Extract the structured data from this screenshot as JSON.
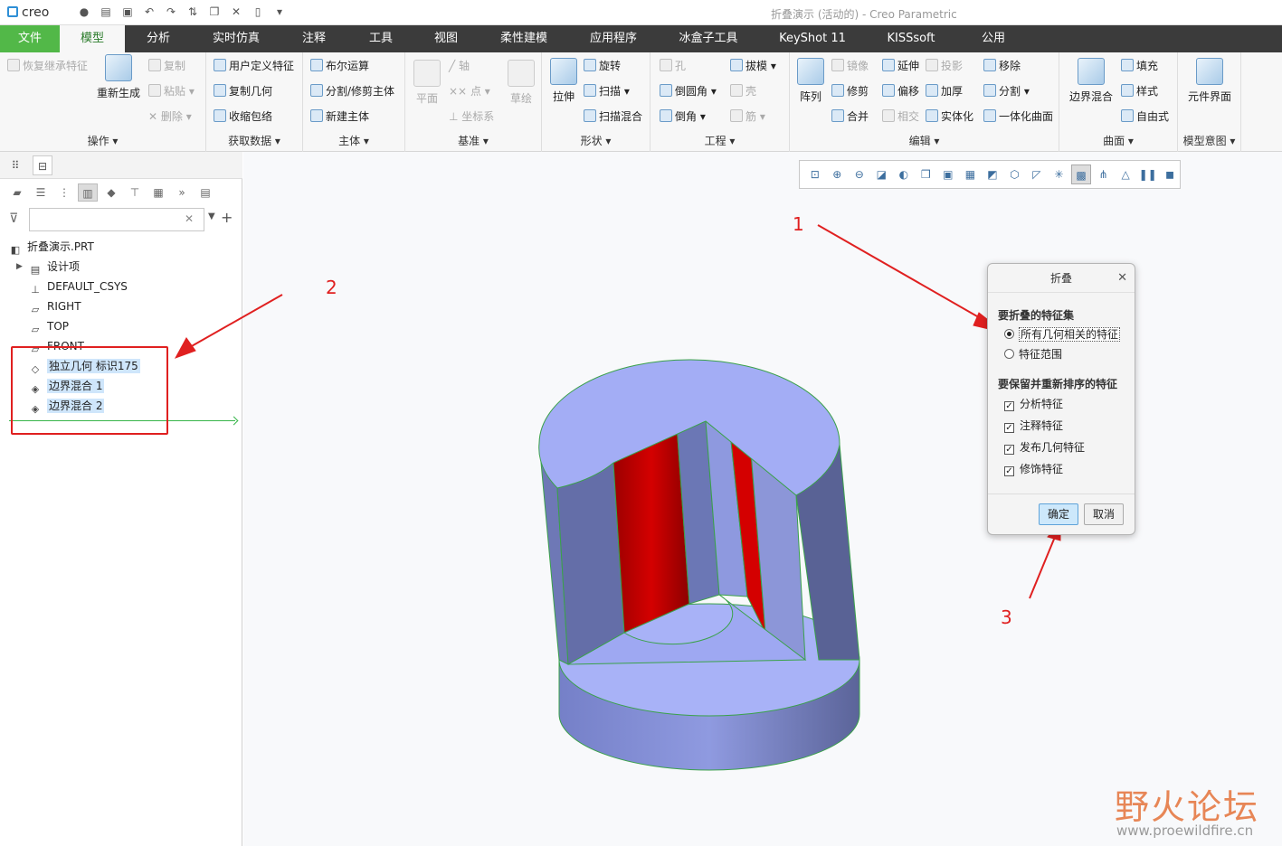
{
  "app": {
    "logo": "creo",
    "window_title": "折叠演示 (活动的) - Creo Parametric"
  },
  "qat_icons": [
    "new-icon",
    "open-icon",
    "save-icon",
    "undo-icon",
    "redo-icon",
    "regenerate-icon",
    "windows-icon",
    "close-icon",
    "blank-icon",
    "more-icon"
  ],
  "tabs": {
    "file": "文件",
    "model": "模型",
    "analysis": "分析",
    "simulation": "实时仿真",
    "annotate": "注释",
    "tools": "工具",
    "view": "视图",
    "flexible": "柔性建模",
    "apps": "应用程序",
    "icebox": "冰盒子工具",
    "keyshot": "KeyShot 11",
    "kisssoft": "KISSsoft",
    "public": "公用"
  },
  "ribbon": {
    "ops": {
      "restore": "恢复继承特征",
      "regen": "重新生成",
      "copy": "复制",
      "paste": "粘贴",
      "delete": "删除",
      "label": "操作"
    },
    "get_data": {
      "udf": "用户定义特征",
      "copy_geom": "复制几何",
      "shrinkwrap": "收缩包络",
      "label": "获取数据"
    },
    "body": {
      "boolean": "布尔运算",
      "split": "分割/修剪主体",
      "new_body": "新建主体",
      "label": "主体"
    },
    "datum": {
      "plane": "平面",
      "axis": "轴",
      "point": "点",
      "csys": "坐标系",
      "sketch": "草绘",
      "label": "基准"
    },
    "shapes": {
      "extrude": "拉伸",
      "revolve": "旋转",
      "sweep": "扫描",
      "swept_blend": "扫描混合",
      "label": "形状"
    },
    "engineering": {
      "hole": "孔",
      "draft": "拔模",
      "round": "倒圆角",
      "shell": "壳",
      "chamfer": "倒角",
      "rib": "筋",
      "label": "工程"
    },
    "editing": {
      "pattern": "阵列",
      "mirror": "镜像",
      "extend": "延伸",
      "project": "投影",
      "trim": "修剪",
      "offset": "偏移",
      "thicken": "加厚",
      "merge": "合并",
      "intersect": "相交",
      "solidify": "实体化",
      "remove": "移除",
      "split": "分割",
      "unify": "一体化曲面",
      "label": "编辑"
    },
    "surfaces": {
      "boundary": "边界混合",
      "fill": "填充",
      "style": "样式",
      "freestyle": "自由式",
      "label": "曲面"
    },
    "intent": {
      "component_interface": "元件界面",
      "label": "模型意图"
    }
  },
  "tree": {
    "filter_placeholder": "",
    "items": [
      {
        "name": "part",
        "label": "折叠演示.PRT",
        "icon": "part-icon"
      },
      {
        "name": "design-items",
        "label": "设计项",
        "icon": "design-items-icon"
      },
      {
        "name": "csys",
        "label": "DEFAULT_CSYS",
        "icon": "csys-icon"
      },
      {
        "name": "right",
        "label": "RIGHT",
        "icon": "datum-plane-icon"
      },
      {
        "name": "top",
        "label": "TOP",
        "icon": "datum-plane-icon"
      },
      {
        "name": "front",
        "label": "FRONT",
        "icon": "datum-plane-icon"
      },
      {
        "name": "indep-geom",
        "label": "独立几何 标识175",
        "icon": "independent-geometry-icon"
      },
      {
        "name": "boundary-1",
        "label": "边界混合 1",
        "icon": "boundary-blend-icon"
      },
      {
        "name": "boundary-2",
        "label": "边界混合 2",
        "icon": "boundary-blend-icon"
      }
    ]
  },
  "dialog": {
    "title": "折叠",
    "section1": "要折叠的特征集",
    "opt_all": "所有几何相关的特征",
    "opt_range": "特征范围",
    "section2": "要保留并重新排序的特征",
    "chk_analysis": "分析特征",
    "chk_annotation": "注释特征",
    "chk_publish": "发布几何特征",
    "chk_cosmetic": "修饰特征",
    "ok": "确定",
    "cancel": "取消"
  },
  "annotations": {
    "n1": "1",
    "n2": "2",
    "n3": "3"
  },
  "watermark": {
    "text": "野火论坛",
    "url": "www.proewildfire.cn"
  },
  "colors": {
    "accent": "#52b848",
    "tab_bar": "#3b3b3b",
    "annotation": "#e02020",
    "model_face": "#9aa6f0",
    "model_cut": "#c00000"
  }
}
